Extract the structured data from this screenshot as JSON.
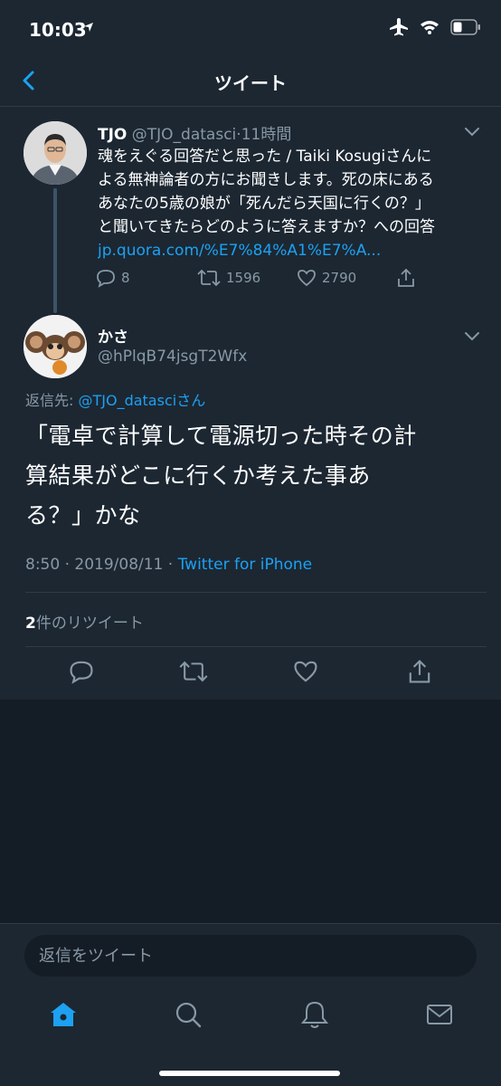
{
  "status_bar": {
    "time": "10:03"
  },
  "nav": {
    "title": "ツイート"
  },
  "parent_tweet": {
    "name": "TJO",
    "handle": "@TJO_datasci",
    "time": "11時間",
    "text_line1": "魂をえぐる回答だと思った / Taiki Kosugiさんに",
    "text_line2": "よる無神論者の方にお聞きします。死の床にある",
    "text_line3": "あなたの5歳の娘が「死んだら天国に行くの？」",
    "text_line4": "と聞いてきたらどのように答えますか？への回答",
    "link": "jp.quora.com/%E7%84%A1%E7%A...",
    "replies": "8",
    "retweets": "1596",
    "likes": "2790"
  },
  "main_tweet": {
    "name": "かさ",
    "handle": "@hPlqB74jsgT2Wfx",
    "reply_prefix": "返信先: ",
    "reply_to": "@TJO_datasci",
    "reply_suffix": "さん",
    "text_line1": "「電卓で計算して電源切った時その計",
    "text_line2": "算結果がどこに行くか考えた事あ",
    "text_line3": "る？」かな",
    "timestamp": "8:50 · 2019/08/11 · ",
    "source": "Twitter for iPhone",
    "retweet_count": "2",
    "retweet_label": "件のリツイート"
  },
  "reply_bar": {
    "placeholder": "返信をツイート"
  },
  "colors": {
    "accent": "#1da1f2",
    "background": "#141d26",
    "panel": "#1c2732",
    "secondary_text": "#8899a6"
  }
}
